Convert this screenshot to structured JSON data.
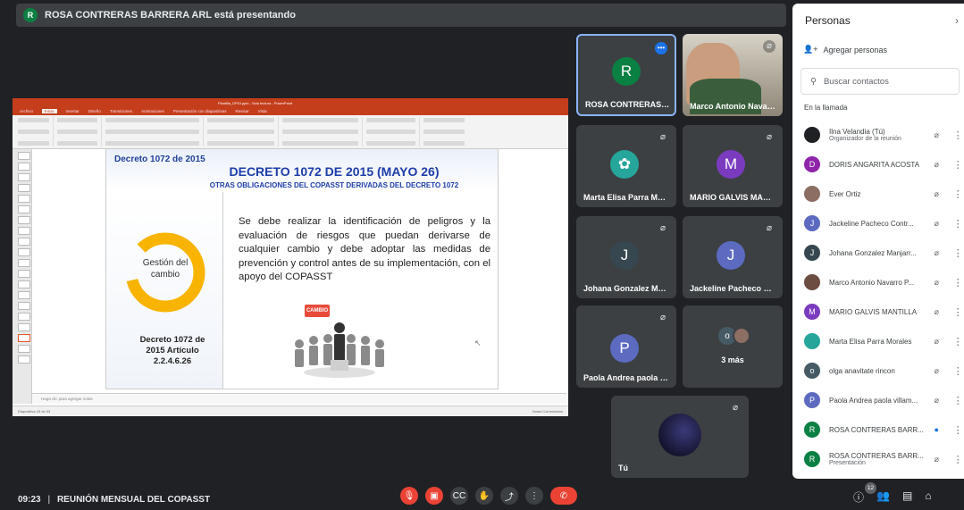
{
  "banner": {
    "avatar_letter": "R",
    "text": "ROSA CONTRERAS BARRERA ARL está presentando"
  },
  "presentation": {
    "window_title": "Plantilla_DPDI.pptx - Solo lectura - PowerPoint",
    "ribbon_tabs": [
      "Archivo",
      "Inicio",
      "Insertar",
      "Diseño",
      "Transiciones",
      "Animaciones",
      "Presentación con diapositivas",
      "Revisar",
      "Vista"
    ],
    "slide": {
      "corner_label": "Decreto 1072 de 2015",
      "title": "DECRETO 1072 DE 2015 (MAYO 26)",
      "subtitle": "OTRAS OBLIGACIONES DEL COPASST DERIVADAS DEL DECRETO 1072",
      "ring_label": "Gestión del cambio",
      "left_caption": "Decreto 1072 de 2015 Artículo 2.2.4.6.26",
      "body": "Se debe realizar la identificación de peligros y la evaluación de riesgos que puedan derivarse de cualquier cambio y debe adoptar las medidas de prevención y control antes de su implementación, con el apoyo del COPASST",
      "cambio_tag": "CAMBIO"
    },
    "notes_placeholder": "Haga clic para agregar notas",
    "status_left": "Diapositiva 43 de 53",
    "status_right": "Notas   Comentarios"
  },
  "tiles": [
    {
      "name": "ROSA CONTRERAS BA...",
      "letter": "R",
      "color": "#0b8043"
    },
    {
      "name": "Marco Antonio Navarro..."
    },
    {
      "name": "Marta Elisa Parra Moral..."
    },
    {
      "name": "MARIO GALVIS MANTI...",
      "letter": "M",
      "color": "#7b3bbf"
    },
    {
      "name": "Johana Gonzalez Manj...",
      "letter": "J",
      "color": "#37474f"
    },
    {
      "name": "Jackeline Pacheco Con...",
      "letter": "J",
      "color": "#5c6bc0"
    },
    {
      "name": "Paola Andrea paola vill...",
      "letter": "P",
      "color": "#5c6bc0"
    },
    {
      "more": "3 más",
      "letter": "o"
    },
    {
      "name": "Tú"
    }
  ],
  "bottom": {
    "time": "09:23",
    "meeting": "REUNIÓN MENSUAL DEL COPASST",
    "participants_count": "12"
  },
  "panel": {
    "title": "Personas",
    "add_people": "Agregar personas",
    "search_placeholder": "Buscar contactos",
    "in_call": "En la llamada",
    "people": [
      {
        "name": "Ilna Velandia (Tú)",
        "sub": "Organizador de la reunión",
        "letter": "",
        "color": "#202124"
      },
      {
        "name": "DORIS ANGARITA ACOSTA",
        "letter": "D",
        "color": "#8e24aa"
      },
      {
        "name": "Ever Ortiz",
        "letter": "",
        "color": "#8d6e63"
      },
      {
        "name": "Jackeline Pacheco Contr...",
        "letter": "J",
        "color": "#5c6bc0"
      },
      {
        "name": "Johana Gonzalez Manjarr...",
        "letter": "J",
        "color": "#37474f"
      },
      {
        "name": "Marco Antonio Navarro P...",
        "letter": "",
        "color": "#6d4c41"
      },
      {
        "name": "MARIO GALVIS MANTILLA",
        "letter": "M",
        "color": "#7b3bbf"
      },
      {
        "name": "Marta Elisa Parra Morales",
        "letter": "",
        "color": "#26a69a"
      },
      {
        "name": "olga anavitate rincon",
        "letter": "o",
        "color": "#455a64"
      },
      {
        "name": "Paola Andrea paola villam...",
        "letter": "P",
        "color": "#5c6bc0"
      },
      {
        "name": "ROSA CONTRERAS BARR...",
        "letter": "R",
        "color": "#0b8043"
      },
      {
        "name": "ROSA CONTRERAS BARR...",
        "sub": "Presentación",
        "letter": "R",
        "color": "#0b8043"
      }
    ]
  }
}
